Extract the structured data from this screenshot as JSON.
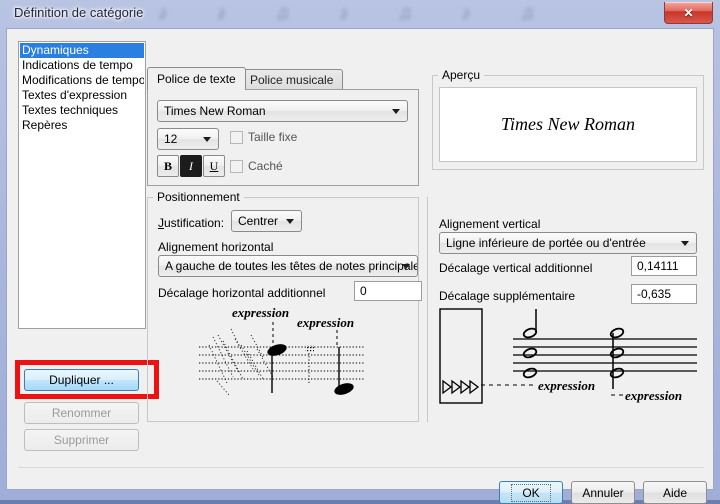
{
  "window": {
    "title": "Définition de catégorie",
    "close_label": "✕",
    "titlebar_notes": "♪ ♪ ♫ ♪ ♫ ♪ ♫"
  },
  "categories": {
    "items": [
      {
        "label": "Dynamiques",
        "selected": true
      },
      {
        "label": "Indications de tempo",
        "selected": false
      },
      {
        "label": "Modifications de tempo",
        "selected": false
      },
      {
        "label": "Textes d'expression",
        "selected": false
      },
      {
        "label": "Textes techniques",
        "selected": false
      },
      {
        "label": "Repères",
        "selected": false
      }
    ]
  },
  "left_buttons": {
    "duplicate": "Dupliquer ...",
    "rename": "Renommer",
    "delete": "Supprimer"
  },
  "tabs": [
    {
      "label": "Police de texte",
      "active": true
    },
    {
      "label": "Police musicale",
      "active": false
    }
  ],
  "font_panel": {
    "font_family_value": "Times New Roman",
    "font_size_value": "12",
    "fixed_size_label": "Taille fixe",
    "hidden_label": "Caché",
    "bold_label": "B",
    "italic_label": "I",
    "underline_label": "U"
  },
  "positioning": {
    "group_title": "Positionnement",
    "justification_label": "ustification:",
    "justification_accel": "J",
    "justification_value": "Centrer",
    "horizontal_alignment_label": "Alignement horizontal",
    "horizontal_alignment_value": "A gauche de toutes les têtes de notes principales",
    "horizontal_offset_label": "Décalage horizontal additionnel",
    "horizontal_offset_value": "0"
  },
  "vertical": {
    "alignment_label": "Alignement vertical",
    "alignment_value": "Ligne inférieure de portée ou d'entrée",
    "vertical_offset_label": "Décalage vertical additionnel",
    "vertical_offset_value": "0,14111",
    "extra_offset_label": "Décalage supplémentaire",
    "extra_offset_value": "-0,635"
  },
  "preview": {
    "group_title": "Aperçu",
    "sample_text": "Times New Roman"
  },
  "notation": {
    "expression_label_1": "expression",
    "expression_label_2": "expression",
    "expression_label_3": "expression",
    "expression_label_4": "expression"
  },
  "bottom_buttons": {
    "ok": "OK",
    "cancel": "Annuler",
    "help": "Aide"
  },
  "colors": {
    "selection_blue": "#2a7fe0",
    "annotation_red": "#ee1111",
    "window_bg": "#f0f0f0"
  }
}
